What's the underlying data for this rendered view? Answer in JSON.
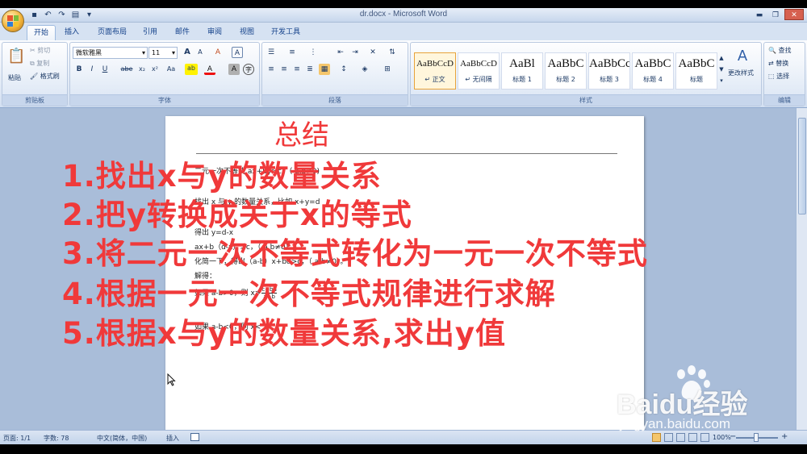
{
  "window": {
    "title": "dr.docx - Microsoft Word",
    "controls": {
      "minimize": "▬",
      "restore": "❐",
      "close": "✕"
    }
  },
  "qat": {
    "icons": [
      "save-icon",
      "undo-icon",
      "redo-icon",
      "quick-print-icon"
    ],
    "glyphs": [
      "▪",
      "↶",
      "↷",
      "▤",
      "▾"
    ]
  },
  "tabs": [
    "开始",
    "插入",
    "页面布局",
    "引用",
    "邮件",
    "审阅",
    "视图",
    "开发工具"
  ],
  "ribbon": {
    "clipboard": {
      "paste": "粘贴",
      "cut": "剪切",
      "copy": "复制",
      "format_painter": "格式刷",
      "label": "剪贴板"
    },
    "font": {
      "font_name": "微软雅黑",
      "font_size": "11",
      "bold": "B",
      "italic": "I",
      "underline": "U",
      "strike": "abe",
      "sub": "x₂",
      "sup": "x²",
      "case": "Aa",
      "grow": "A",
      "shrink": "A",
      "clear": "A",
      "char_border": "A",
      "label": "字体"
    },
    "paragraph": {
      "label": "段落"
    },
    "styles": {
      "items": [
        {
          "preview": "AaBbCcD",
          "name": "↵ 正文",
          "big": false,
          "active": true
        },
        {
          "preview": "AaBbCcD",
          "name": "↵ 无间隔",
          "big": false,
          "active": false
        },
        {
          "preview": "AaBl",
          "name": "标题 1",
          "big": true,
          "active": false
        },
        {
          "preview": "AaBbC",
          "name": "标题 2",
          "big": true,
          "active": false
        },
        {
          "preview": "AaBbCc",
          "name": "标题 3",
          "big": true,
          "active": false
        },
        {
          "preview": "AaBbC",
          "name": "标题 4",
          "big": true,
          "active": false
        },
        {
          "preview": "AaBbC",
          "name": "标题",
          "big": true,
          "active": false
        }
      ],
      "change_styles": "更改样式",
      "label": "样式"
    },
    "editing": {
      "find": "查找",
      "replace": "替换",
      "select": "选择",
      "label": "编辑"
    }
  },
  "document": {
    "lines": [
      "二元一次不等式 ax+by>c，（ a,b≠0)",
      "找出 x 与 y 的数量关系，比如 x+y=d",
      "得出 y=d-x",
      "ax+b（d-x）>c，（ a,b≠0）",
      "化简一下，得出（a-b）x+bd>c，（ a,b≠0）。",
      "解得：",
      "如果 a-b>0，则 x>",
      "如果 a-b<0，则 x<"
    ],
    "fraction": {
      "numerator": "c−bd",
      "denominator": "a−b"
    }
  },
  "statusbar": {
    "page": "页面: 1/1",
    "words": "字数: 78",
    "language": "中文(简体，中国)",
    "mode": "插入",
    "zoom": "100%",
    "zoom_minus": "−",
    "zoom_plus": "+"
  },
  "overlay": {
    "title": "总结",
    "lines": [
      "1.找出x与y的数量关系",
      "2.把y转换成关于x的等式",
      "3.将二元一次不等式转化为一元一次不等式",
      "4.根据一元一次不等式规律进行求解",
      "5.根据x与y的数量关系,求出y值"
    ],
    "color": "#f0393a"
  },
  "watermark": {
    "brand": "Baidu经验",
    "url": "jingyan.baidu.com"
  }
}
